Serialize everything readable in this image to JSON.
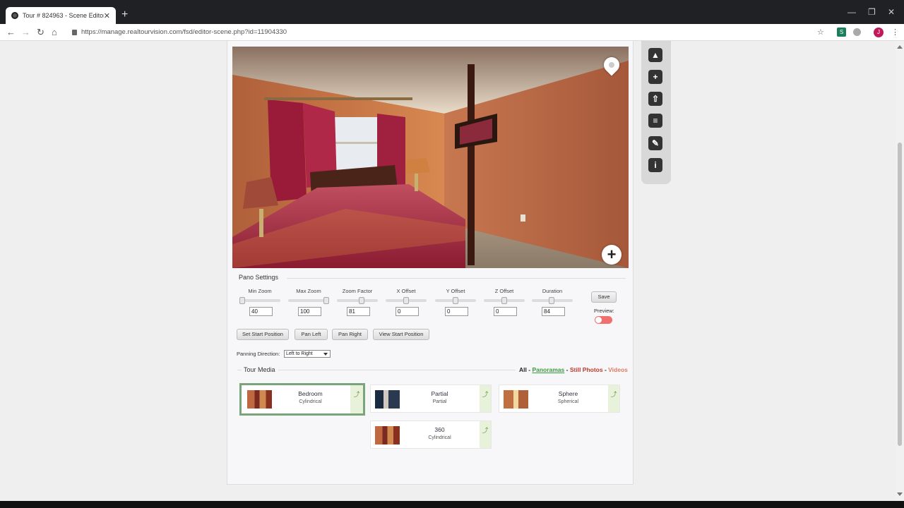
{
  "browser": {
    "tab_title": "Tour # 824963 - Scene Editor",
    "tab_close": "✕",
    "new_tab": "+",
    "url": "https://manage.realtourvision.com/fsd/editor-scene.php?id=11904330",
    "back": "←",
    "forward": "→",
    "reload": "↻",
    "home": "⌂",
    "star": "☆",
    "ext_label": "S",
    "avatar_letter": "J",
    "menu": "⋮",
    "minimize": "—",
    "restore": "❐",
    "close": "✕"
  },
  "pano_settings": {
    "title": "Pano Settings",
    "sliders": [
      {
        "label": "Min Zoom",
        "value": "40",
        "level": 0.0
      },
      {
        "label": "Max Zoom",
        "value": "100",
        "level": 1.0
      },
      {
        "label": "Zoom Factor",
        "value": "81",
        "level": 0.62
      },
      {
        "label": "X Offset",
        "value": "0",
        "level": 0.5
      },
      {
        "label": "Y Offset",
        "value": "0",
        "level": 0.5
      },
      {
        "label": "Z Offset",
        "value": "0",
        "level": 0.5
      },
      {
        "label": "Duration",
        "value": "84",
        "level": 0.48
      }
    ],
    "save": "Save",
    "preview_label": "Preview:",
    "buttons": {
      "set_start": "Set Start Position",
      "pan_left": "Pan Left",
      "pan_right": "Pan Right",
      "view_start": "View Start Position"
    },
    "panning_label": "Panning Direction:",
    "panning_value": "Left to Right"
  },
  "tour_media": {
    "title": "Tour Media",
    "filters": {
      "all": "All",
      "panoramas": "Panoramas",
      "still": "Still Photos",
      "videos": "Videos",
      "sep": " - "
    },
    "items": [
      {
        "name": "Bedroom",
        "type": "Cylindrical"
      },
      {
        "name": "Partial",
        "type": "Partial"
      },
      {
        "name": "Sphere",
        "type": "Spherical"
      },
      {
        "name": "360",
        "type": "Cylindrical"
      }
    ]
  },
  "toolbar_icons": [
    "bell-icon",
    "plus-icon",
    "upload-icon",
    "list-icon",
    "edit-icon",
    "info-icon"
  ]
}
